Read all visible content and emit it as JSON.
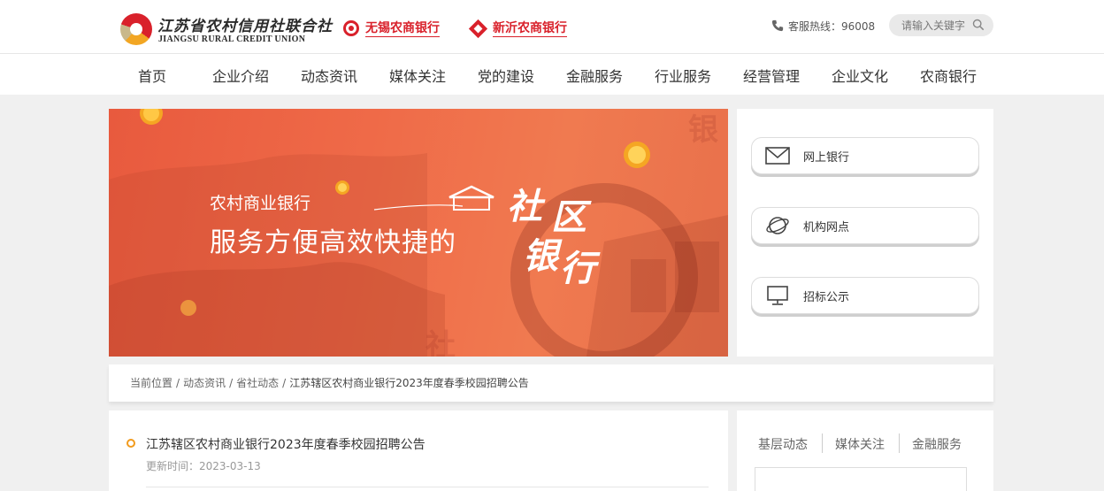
{
  "header": {
    "logo_cn": "江苏省农村信用社联合社",
    "logo_en": "JIANGSU RURAL CREDIT UNION",
    "bank_links": [
      "无锡农商银行",
      "新沂农商银行"
    ],
    "hotline": "客服热线：96008",
    "search_placeholder": "请输入关键字"
  },
  "nav": [
    "首页",
    "企业介绍",
    "动态资讯",
    "媒体关注",
    "党的建设",
    "金融服务",
    "行业服务",
    "经营管理",
    "企业文化",
    "农商银行"
  ],
  "banner": {
    "line1": "农村商业银行",
    "line2": "服务方便高效快捷的",
    "big_chars": [
      "社",
      "区",
      "银",
      "行"
    ]
  },
  "side_links": [
    {
      "label": "网上银行",
      "icon": "mail-icon"
    },
    {
      "label": "机构网点",
      "icon": "globe-icon"
    },
    {
      "label": "招标公示",
      "icon": "monitor-icon"
    }
  ],
  "breadcrumb": {
    "items": [
      "当前位置",
      "动态资讯",
      "省社动态"
    ],
    "current": "江苏辖区农村商业银行2023年度春季校园招聘公告"
  },
  "article": {
    "title": "江苏辖区农村商业银行2023年度春季校园招聘公告",
    "date": "更新时间：2023-03-13"
  },
  "aside_tabs": [
    "基层动态",
    "媒体关注",
    "金融服务"
  ],
  "colors": {
    "brand_red": "#d9212b",
    "accent_orange": "#f29b1d",
    "banner_orange": "#ef6a48"
  }
}
